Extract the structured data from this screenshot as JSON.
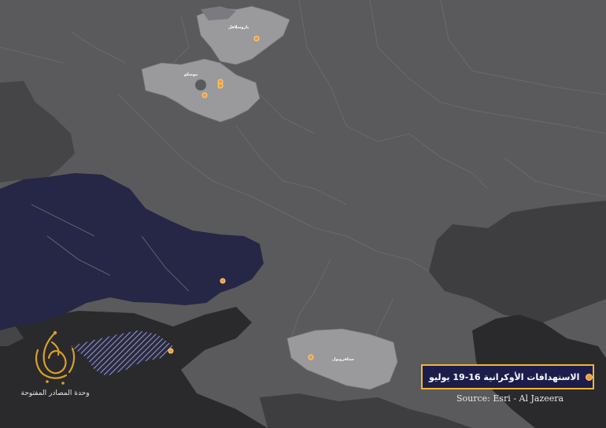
{
  "map": {
    "legend": {
      "label": "الاستهدافات الأوكرانية 16-19 يوليو",
      "marker_color": "#f29a3b",
      "border_color": "#f0b72f",
      "background_color": "#1c1d4a"
    },
    "source": "Source: Esri - Al Jazeera",
    "logo": {
      "icon": "al-jazeera-logo-icon",
      "caption": "وحدة المصادر المفتوحة",
      "color": "#d9a02a"
    },
    "places": [
      {
        "name": "ياروسلافل"
      },
      {
        "name": "موسكو"
      },
      {
        "name": "ستافروبول"
      }
    ],
    "colors": {
      "russia": "#5a5a5c",
      "highlight_region": "#9a9a9c",
      "ukraine": "#262646",
      "crimea_hatch": "#8a8ab0",
      "sea": "#2a2a2c",
      "neighbors": "#3e3e40"
    }
  }
}
